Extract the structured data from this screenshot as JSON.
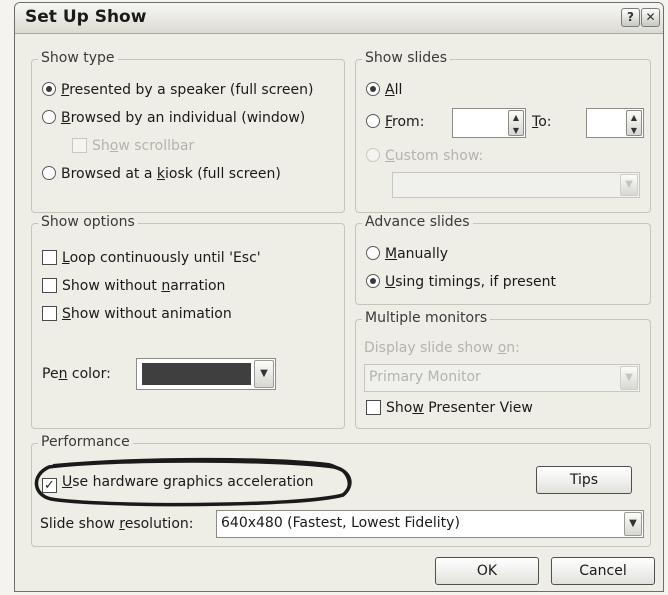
{
  "dialog": {
    "title": "Set Up Show",
    "help_icon": "help-icon",
    "close_icon": "close-icon"
  },
  "show_type": {
    "legend": "Show type",
    "options": [
      {
        "pre": "",
        "ul": "P",
        "post": "resented by a speaker (full screen)",
        "selected": true
      },
      {
        "pre": "",
        "ul": "B",
        "post": "rowsed by an individual (window)",
        "selected": false
      },
      {
        "pre": "",
        "ul": "",
        "post": "Browsed at a kiosk (full screen)",
        "selected": false
      }
    ],
    "show_scrollbar": {
      "pre": "Sh",
      "ul": "o",
      "post": "w scrollbar",
      "checked": false,
      "disabled": true
    },
    "kiosk_pre": "Browsed at a ",
    "kiosk_ul": "k",
    "kiosk_post": "iosk (full screen)"
  },
  "show_slides": {
    "legend": "Show slides",
    "all": {
      "pre": "",
      "ul": "A",
      "post": "ll",
      "selected": true
    },
    "from": {
      "pre": "",
      "ul": "F",
      "post": "rom:",
      "selected": false,
      "value": ""
    },
    "to": {
      "pre": "",
      "ul": "T",
      "post": "o:",
      "value": ""
    },
    "custom_show": {
      "pre": "",
      "ul": "C",
      "post": "ustom show:",
      "disabled": true,
      "value": ""
    }
  },
  "show_options": {
    "legend": "Show options",
    "loop": {
      "pre": "",
      "ul": "L",
      "post": "oop continuously until 'Esc'",
      "checked": false
    },
    "no_narration": {
      "pre": "Show without ",
      "ul": "n",
      "post": "arration",
      "checked": false
    },
    "no_animation": {
      "pre": "",
      "ul": "S",
      "post": "how without animation",
      "checked": false
    },
    "pen_color": {
      "pre": "Pe",
      "ul": "n",
      "post": " color:",
      "swatch": "#3f3f3f"
    }
  },
  "advance_slides": {
    "legend": "Advance slides",
    "manually": {
      "pre": "",
      "ul": "M",
      "post": "anually",
      "selected": false
    },
    "timings": {
      "pre": "",
      "ul": "U",
      "post": "sing timings, if present",
      "selected": true
    }
  },
  "multiple_monitors": {
    "legend": "Multiple monitors",
    "display_on": {
      "pre": "Display slide show ",
      "ul": "o",
      "post": "n:",
      "disabled": true
    },
    "monitor_value": "Primary Monitor",
    "presenter_view": {
      "pre": "Sho",
      "ul": "w",
      "post": " Presenter View",
      "checked": false
    }
  },
  "performance": {
    "legend": "Performance",
    "hw_accel": {
      "pre": "",
      "ul": "U",
      "post": "se hardware graphics acceleration",
      "checked": true
    },
    "tips_label": "Tips",
    "resolution_label": {
      "pre": "Slide show ",
      "ul": "r",
      "post": "esolution:"
    },
    "resolution_value": "640x480 (Fastest, Lowest Fidelity)"
  },
  "buttons": {
    "ok": "OK",
    "cancel": "Cancel"
  },
  "colors": {
    "dialog_bg": "#eeede6",
    "highlight_scribble": "#1a1a1a"
  }
}
